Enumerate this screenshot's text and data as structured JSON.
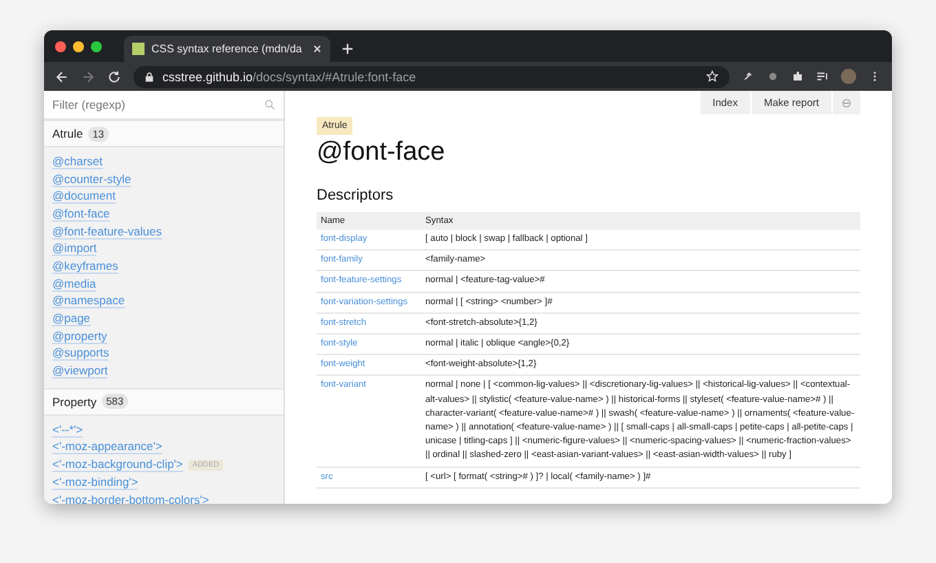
{
  "browser": {
    "tab_title": "CSS syntax reference (mdn/da",
    "url_host": "csstree.github.io",
    "url_path": "/docs/syntax/#Atrule:font-face"
  },
  "sidebar": {
    "filter_placeholder": "Filter (regexp)",
    "sections": [
      {
        "title": "Atrule",
        "count": "13",
        "items": [
          {
            "label": "@charset"
          },
          {
            "label": "@counter-style"
          },
          {
            "label": "@document"
          },
          {
            "label": "@font-face"
          },
          {
            "label": "@font-feature-values"
          },
          {
            "label": "@import"
          },
          {
            "label": "@keyframes"
          },
          {
            "label": "@media"
          },
          {
            "label": "@namespace"
          },
          {
            "label": "@page"
          },
          {
            "label": "@property"
          },
          {
            "label": "@supports"
          },
          {
            "label": "@viewport"
          }
        ]
      },
      {
        "title": "Property",
        "count": "583",
        "items": [
          {
            "label": "<'--*'>"
          },
          {
            "label": "<'-moz-appearance'>"
          },
          {
            "label": "<'-moz-background-clip'>",
            "badge": "ADDED"
          },
          {
            "label": "<'-moz-binding'>"
          },
          {
            "label": "<'-moz-border-bottom-colors'>"
          }
        ]
      }
    ]
  },
  "toolbar": {
    "buttons": [
      "Index",
      "Make report"
    ]
  },
  "main": {
    "badge": "Atrule",
    "title": "@font-face",
    "section_title": "Descriptors",
    "table": {
      "columns": [
        "Name",
        "Syntax"
      ],
      "rows": [
        {
          "name": "font-display",
          "syntax": "[ auto | block | swap | fallback | optional ]"
        },
        {
          "name": "font-family",
          "syntax": "<family-name>"
        },
        {
          "name": "font-feature-settings",
          "syntax": "normal | <feature-tag-value>#"
        },
        {
          "name": "font-variation-settings",
          "syntax": "normal | [ <string> <number> ]#"
        },
        {
          "name": "font-stretch",
          "syntax": "<font-stretch-absolute>{1,2}"
        },
        {
          "name": "font-style",
          "syntax": "normal | italic | oblique <angle>{0,2}"
        },
        {
          "name": "font-weight",
          "syntax": "<font-weight-absolute>{1,2}"
        },
        {
          "name": "font-variant",
          "syntax": "normal | none | [ <common-lig-values> || <discretionary-lig-values> || <historical-lig-values> || <contextual-alt-values> || stylistic( <feature-value-name> ) || historical-forms || styleset( <feature-value-name># ) || character-variant( <feature-value-name># ) || swash( <feature-value-name> ) || ornaments( <feature-value-name> ) || annotation( <feature-value-name> ) || [ small-caps | all-small-caps | petite-caps | all-petite-caps | unicase | titling-caps ] || <numeric-figure-values> || <numeric-spacing-values> || <numeric-fraction-values> || ordinal || slashed-zero || <east-asian-variant-values> || <east-asian-width-values> || ruby ]"
        },
        {
          "name": "src",
          "syntax": "[ <url> [ format( <string># ) ]? | local( <family-name> ) ]#"
        }
      ]
    }
  }
}
